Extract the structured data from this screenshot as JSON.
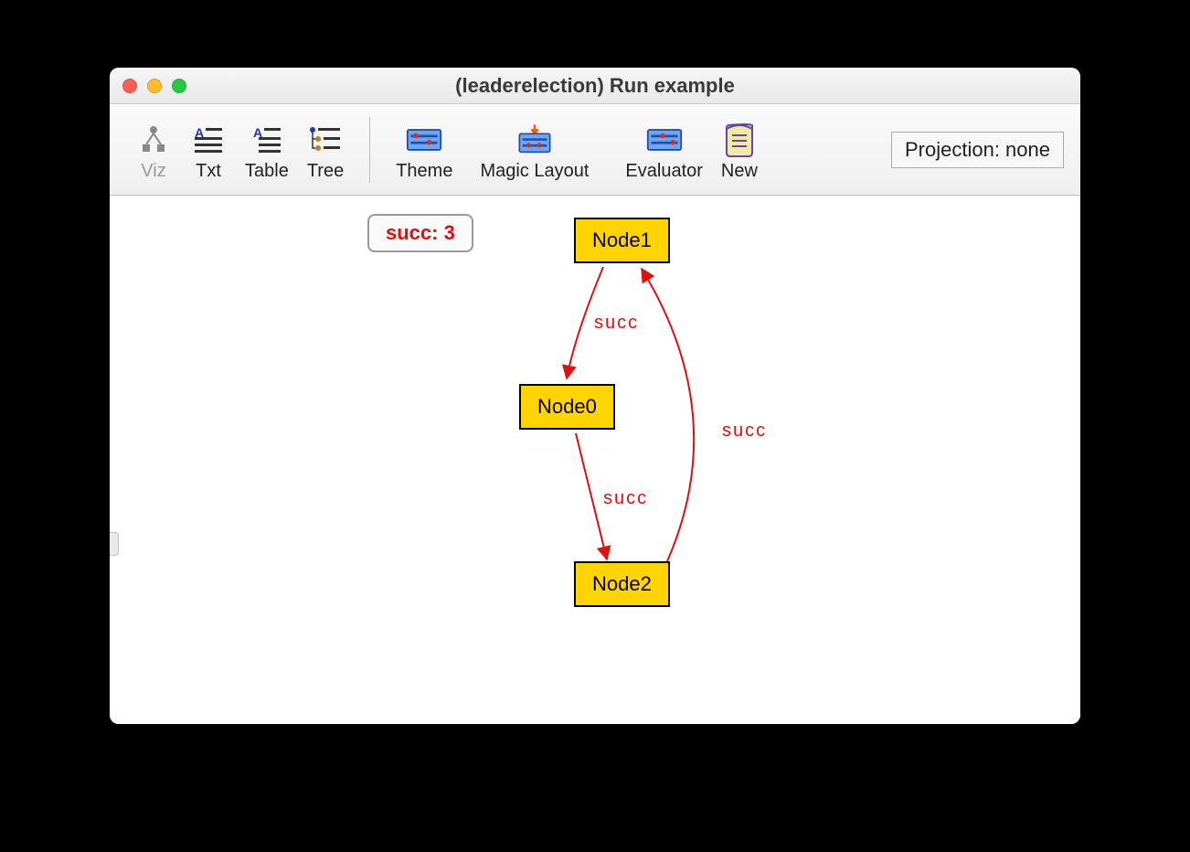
{
  "window": {
    "title": "(leaderelection) Run example"
  },
  "toolbar": {
    "viz": "Viz",
    "txt": "Txt",
    "table": "Table",
    "tree": "Tree",
    "theme": "Theme",
    "magic_layout": "Magic Layout",
    "evaluator": "Evaluator",
    "new": "New",
    "projection": "Projection: none"
  },
  "legend": {
    "text": "succ: 3"
  },
  "nodes": {
    "node1": "Node1",
    "node0": "Node0",
    "node2": "Node2"
  },
  "edges": {
    "e1": "succ",
    "e2": "succ",
    "e3": "succ"
  }
}
